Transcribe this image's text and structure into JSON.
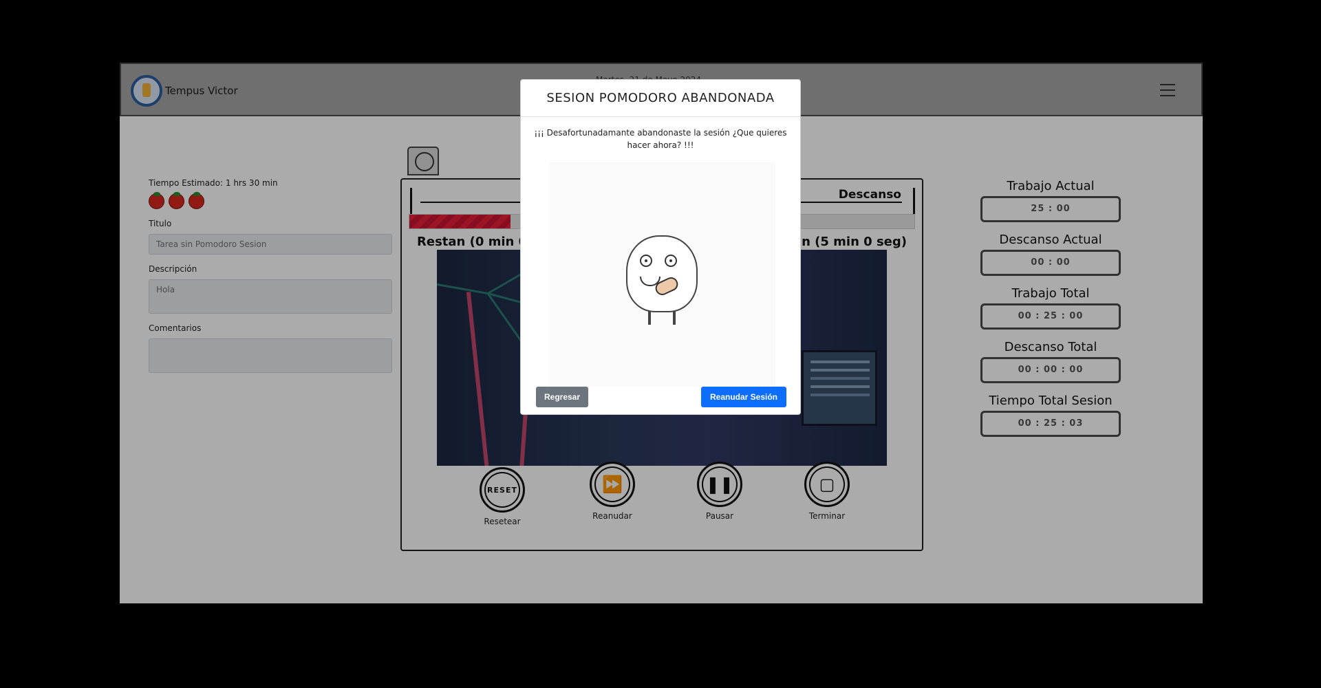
{
  "header": {
    "brand": "Tempus Victor",
    "date": "Martes, 21 de Mayo 2024"
  },
  "form": {
    "estimate": "Tiempo Estimado: 1 hrs 30 min",
    "tomato_count": 3,
    "title_label": "Titulo",
    "title_value": "Tarea sin Pomodoro Sesion",
    "desc_label": "Descripción",
    "desc_value": "Hola",
    "comments_label": "Comentarios",
    "comments_value": ""
  },
  "timer": {
    "break_label": "Descanso",
    "left_remaining": "Restan (0 min 0",
    "right_remaining": "an (5 min 0 seg)",
    "progress_fraction": 0.2
  },
  "controls": {
    "reset_text": "RESET",
    "reset_label": "Resetear",
    "resume_label": "Reanudar",
    "pause_label": "Pausar",
    "stop_label": "Terminar"
  },
  "stats": {
    "work_current_label": "Trabajo Actual",
    "work_current_value": "25 : 00",
    "break_current_label": "Descanso Actual",
    "break_current_value": "00 : 00",
    "work_total_label": "Trabajo Total",
    "work_total_value": "00 : 25 : 00",
    "break_total_label": "Descanso Total",
    "break_total_value": "00 : 00 : 00",
    "session_total_label": "Tiempo Total Sesion",
    "session_total_value": "00 : 25 : 03"
  },
  "modal": {
    "title": "SESION POMODORO ABANDONADA",
    "message": "¡¡¡ Desafortunadamante abandonaste la sesión ¿Que quieres hacer ahora? !!!",
    "back_button": "Regresar",
    "resume_button": "Reanudar Sesión"
  },
  "colors": {
    "primary": "#0d6efd",
    "secondary": "#6c757d",
    "progress_red": "#e8203a",
    "header_gray": "#a6a6a6"
  },
  "icons": {
    "menu": "hamburger-icon",
    "tomato": "tomato-icon",
    "reset": "reset-icon",
    "resume": "fast-forward-icon",
    "pause": "pause-icon",
    "stop": "stop-icon"
  }
}
